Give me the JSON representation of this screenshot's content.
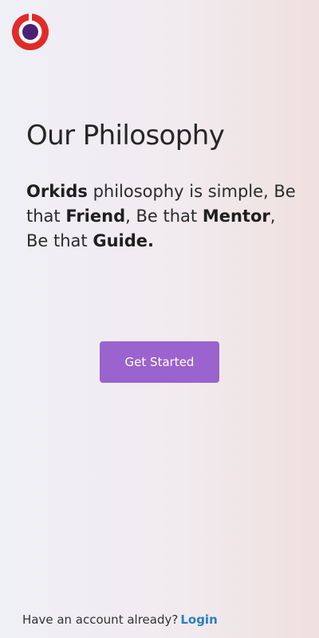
{
  "brand": {
    "logo_icon": "orkids-logo-icon",
    "logo_outer_color": "#e02b27",
    "logo_ring_color": "#ffffff",
    "logo_inner_color": "#4b1f73"
  },
  "hero": {
    "title": "Our Philosophy",
    "brand_name": "Orkids",
    "text_1": " philosophy is simple, Be that ",
    "highlight_1": "Friend",
    "text_2": ", Be that ",
    "highlight_2": "Mentor",
    "text_3": ", Be that ",
    "highlight_3": "Guide."
  },
  "cta": {
    "label": "Get Started",
    "color": "#9b63cd"
  },
  "footer": {
    "prompt": "Have an account already?",
    "login_label": "Login",
    "link_color": "#2a7fbf"
  }
}
